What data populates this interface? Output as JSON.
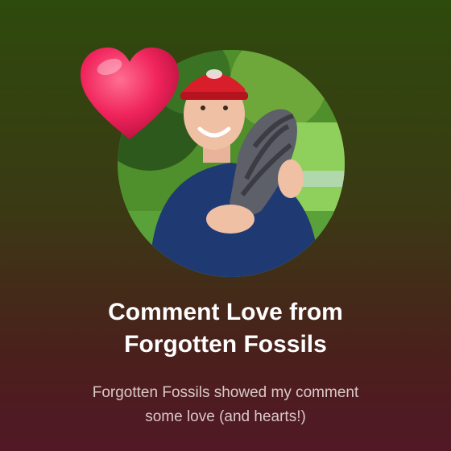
{
  "notification": {
    "title_line1": "Comment Love from",
    "title_line2": "Forgotten Fossils",
    "message_line1": "Forgotten Fossils showed my comment",
    "message_line2": "some love (and hearts!)"
  },
  "icons": {
    "heart": "heart-icon",
    "avatar": "avatar"
  },
  "colors": {
    "background_top": "#2e4a0c",
    "background_bottom": "#521826",
    "heart": "#f0245c",
    "title_text": "#ffffff",
    "message_text": "#d9c9c7"
  }
}
